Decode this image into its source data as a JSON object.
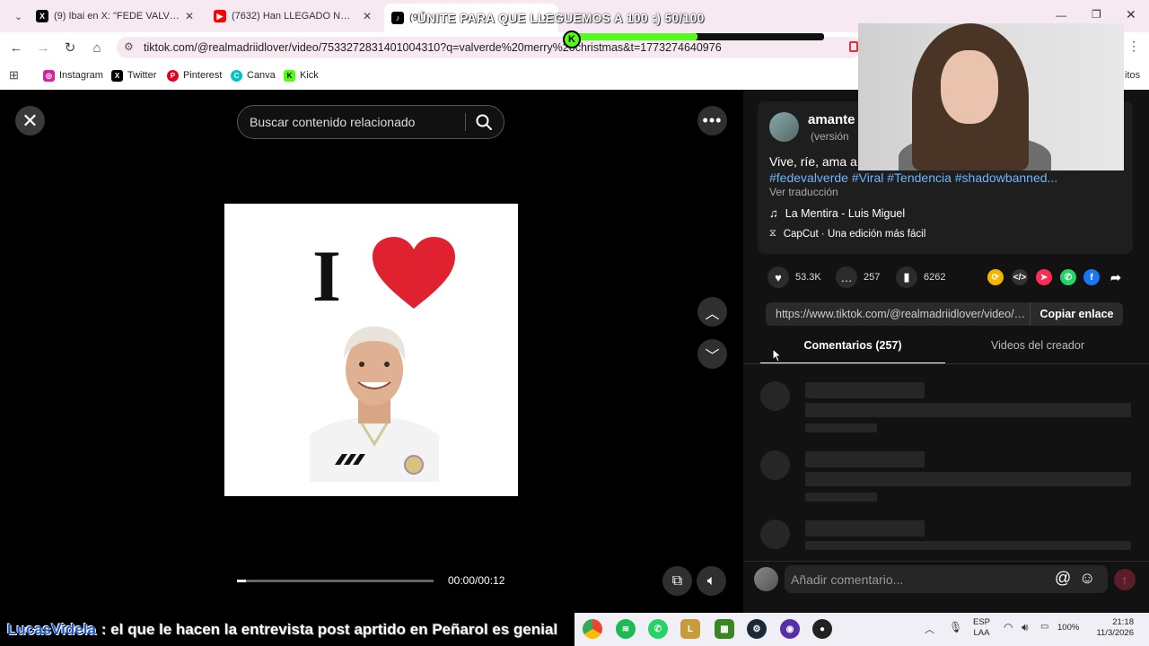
{
  "browser": {
    "tabs": [
      {
        "title": "(9) Ibai en X: \"FEDE VALVERDE F",
        "color": "#000000",
        "glyph": "X"
      },
      {
        "title": "(7632) Han LLEGADO NUEVOS",
        "color": "#ff0000",
        "glyph": "▶"
      },
      {
        "title": "(9)",
        "color": "#000000",
        "glyph": "♪"
      }
    ],
    "url": "tiktok.com/@realmadriidlover/video/7533272831401004310?q=valverde%20merry%20christmas&t=1773274640976",
    "bookmarks": [
      {
        "label": "Instagram",
        "color": "#d6249f",
        "glyph": "◎"
      },
      {
        "label": "Twitter",
        "color": "#000000",
        "glyph": "X"
      },
      {
        "label": "Pinterest",
        "color": "#e60023",
        "glyph": "P"
      },
      {
        "label": "Canva",
        "color": "#00c4cc",
        "glyph": "C"
      },
      {
        "label": "Kick",
        "color": "#53fc18",
        "glyph": "K"
      }
    ],
    "bookmarks_more": "itos"
  },
  "stream": {
    "goal_text": "ÚNITE PARA QUE LLEGUEMOS A 100 :) 50/100",
    "goal_progress": 0.5,
    "goal_badge": "K",
    "ticker_name": "LucasVidela",
    "ticker_text": ": el que le hacen la entrevista post aprtido en Peñarol es genial"
  },
  "viewer": {
    "search_placeholder": "Buscar contenido relacionado",
    "video_big_letter": "I",
    "time": "00:00/00:12",
    "progress": 0.0
  },
  "panel": {
    "author": "amante",
    "author_sub": "(versión",
    "caption": "Vive, ríe, ama a F",
    "hashtags": "#fedevalverde #Viral #Tendencia #shadowbanned...",
    "translate": "Ver traducción",
    "music": "La Mentira - Luis Miguel",
    "capcut": "CapCut · Una edición más fácil",
    "likes": "53.3K",
    "comments": "257",
    "saves": "6262",
    "link": "https://www.tiktok.com/@realmadriidlover/video/7...",
    "copy_link": "Copiar enlace",
    "tab_comments": "Comentarios (257)",
    "tab_videos": "Videos del creador",
    "comment_placeholder": "Añadir comentario..."
  },
  "taskbar": {
    "lang": "ESP",
    "lang2": "LAA",
    "battery": "100%",
    "time": "21:18",
    "date": "11/3/2026"
  }
}
